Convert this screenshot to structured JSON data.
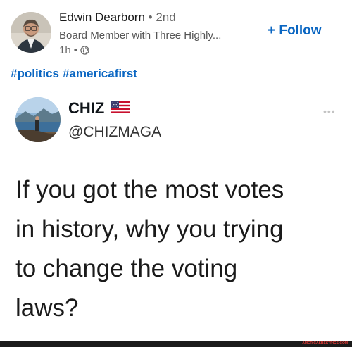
{
  "post": {
    "author": {
      "name": "Edwin Dearborn",
      "separator": "•",
      "degree": "2nd"
    },
    "headline": "Board Member with Three Highly...",
    "time": "1h",
    "meta_separator": "•",
    "visibility_icon": "globe-icon",
    "follow_label": "+ Follow",
    "hashtags": [
      "#politics",
      "#americafirst"
    ]
  },
  "tweet": {
    "display_name": "CHIZ",
    "flag_icon": "us-flag-icon",
    "handle": "@CHIZMAGA",
    "more_label": "•••",
    "text": "If you got the most votes\nin history, why you trying\nto change the voting\nlaws?"
  },
  "watermark": "AMERICASBESTPICS.COM",
  "colors": {
    "link_blue": "#0a66c2",
    "text": "#191919",
    "muted": "#666666"
  }
}
